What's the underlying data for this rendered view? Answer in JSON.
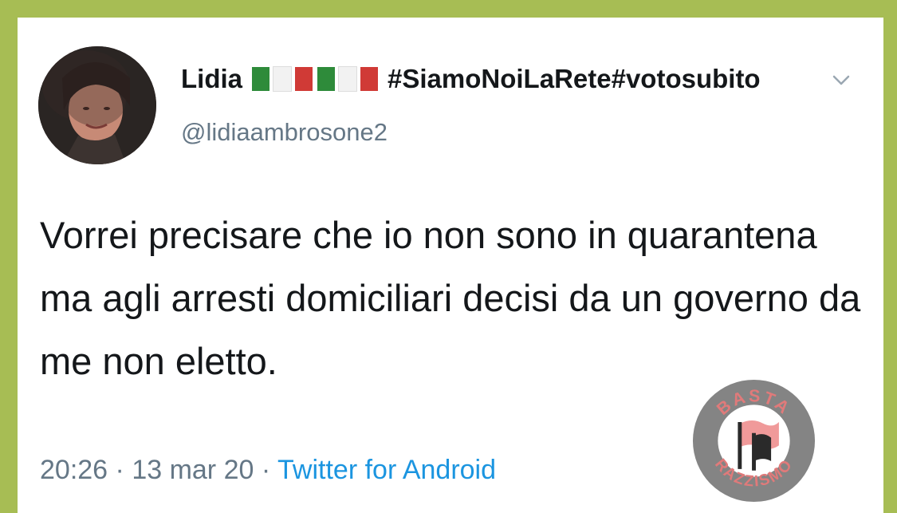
{
  "user": {
    "display_name": "Lidia",
    "flag_emoji": "🇮🇹🇮🇹🇮🇹",
    "hashtags": "#SiamoNoiLaRete#votosubito",
    "handle": "@lidiaambrosone2"
  },
  "tweet": {
    "text": "Vorrei precisare che io non sono in quarantena ma agli arresti domiciliari decisi da un governo da me non eletto."
  },
  "meta": {
    "time": "20:26",
    "separator": " · ",
    "date": "13 mar 20",
    "source": "Twitter for Android"
  },
  "badge": {
    "top_text": "BASTA",
    "bottom_text": "RAZZISMO"
  },
  "icons": {
    "menu": "chevron-down-icon",
    "flag": "italy-flag-icon"
  },
  "colors": {
    "frame": "#a7bd54",
    "link": "#1b95e0",
    "muted": "#657786",
    "badge_ring": "#d25a5a"
  }
}
